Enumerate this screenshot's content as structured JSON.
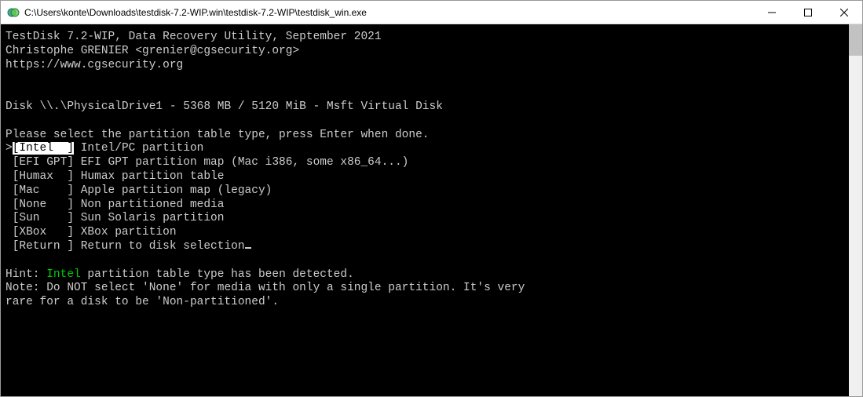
{
  "window": {
    "title": "C:\\Users\\konte\\Downloads\\testdisk-7.2-WIP.win\\testdisk-7.2-WIP\\testdisk_win.exe"
  },
  "header": {
    "line1": "TestDisk 7.2-WIP, Data Recovery Utility, September 2021",
    "line2": "Christophe GRENIER <grenier@cgsecurity.org>",
    "line3": "https://www.cgsecurity.org"
  },
  "disk_info": "Disk \\\\.\\PhysicalDrive1 - 5368 MB / 5120 MiB - Msft Virtual Disk",
  "prompt": "Please select the partition table type, press Enter when done.",
  "menu": [
    {
      "key": "[Intel  ]",
      "desc": "Intel/PC partition",
      "selected": true
    },
    {
      "key": "[EFI GPT]",
      "desc": "EFI GPT partition map (Mac i386, some x86_64...)",
      "selected": false
    },
    {
      "key": "[Humax  ]",
      "desc": "Humax partition table",
      "selected": false
    },
    {
      "key": "[Mac    ]",
      "desc": "Apple partition map (legacy)",
      "selected": false
    },
    {
      "key": "[None   ]",
      "desc": "Non partitioned media",
      "selected": false
    },
    {
      "key": "[Sun    ]",
      "desc": "Sun Solaris partition",
      "selected": false
    },
    {
      "key": "[XBox   ]",
      "desc": "XBox partition",
      "selected": false
    },
    {
      "key": "[Return ]",
      "desc": "Return to disk selection",
      "selected": false
    }
  ],
  "hint": {
    "prefix": "Hint: ",
    "detected": "Intel",
    "suffix": " partition table type has been detected."
  },
  "note": "Note: Do NOT select 'None' for media with only a single partition. It's very\nrare for a disk to be 'Non-partitioned'."
}
